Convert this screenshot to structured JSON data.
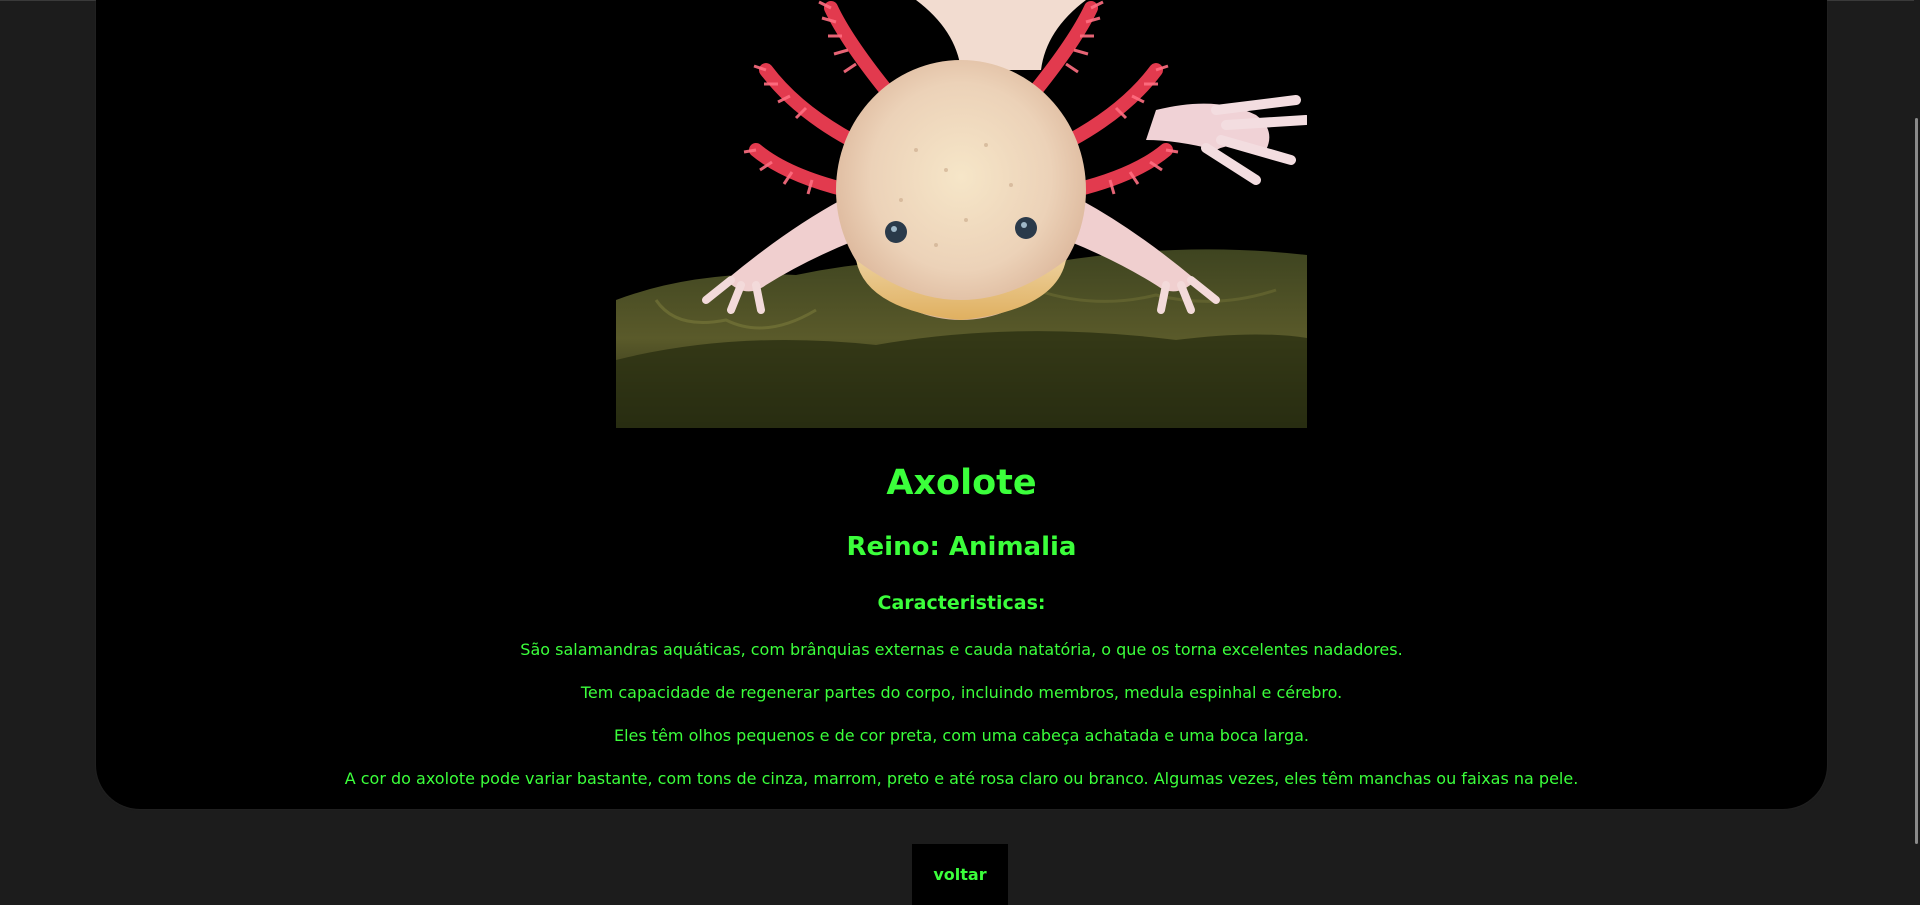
{
  "colors": {
    "accent": "#3bff3b",
    "page_background": "#1c1c1c",
    "card_background": "#000000"
  },
  "animal": {
    "name": "Axolote",
    "kingdom": "Reino: Animalia",
    "characteristics_heading": "Caracteristicas:",
    "facts": [
      "São salamandras aquáticas, com brânquias externas e cauda natatória, o que os torna excelentes nadadores.",
      "Tem capacidade de regenerar partes do corpo, incluindo membros, medula espinhal e cérebro.",
      "Eles têm olhos pequenos e de cor preta, com uma cabeça achatada e uma boca larga.",
      "A cor do axolote pode variar bastante, com tons de cinza, marrom, preto e até rosa claro ou branco. Algumas vezes, eles têm manchas ou faixas na pele."
    ]
  },
  "navigation": {
    "back_label": "voltar"
  }
}
